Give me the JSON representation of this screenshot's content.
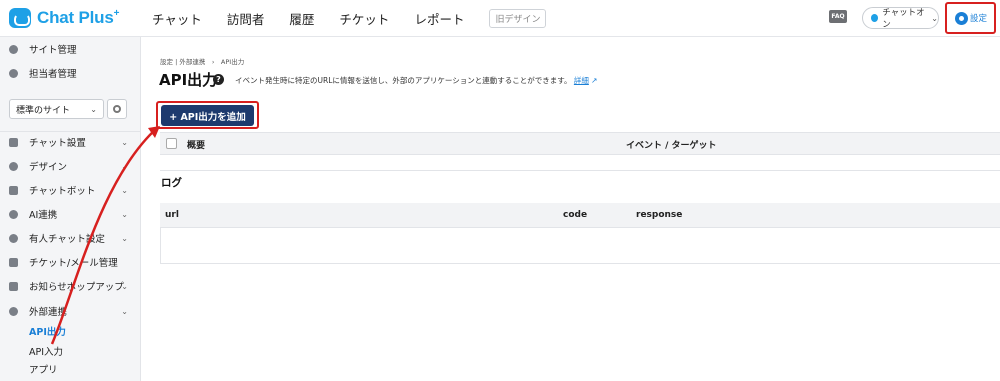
{
  "header": {
    "logo": "Chat Plus",
    "logo_plus": "+",
    "nav": [
      "チャット",
      "訪問者",
      "履歴",
      "チケット",
      "レポート"
    ],
    "old_design": "旧デザイン",
    "faq": "FAQ",
    "chat_status": "チャットオン",
    "settings": "設定"
  },
  "sidebar": {
    "site_manage": "サイト管理",
    "staff_manage": "担当者管理",
    "site_select": "標準のサイト",
    "items": [
      "チャット設置",
      "デザイン",
      "チャットボット",
      "AI連携",
      "有人チャット設定",
      "チケット/メール管理",
      "お知らせポップアップ",
      "外部連携"
    ],
    "subitems": [
      "API出力",
      "API入力",
      "アプリ"
    ]
  },
  "main": {
    "breadcrumb": "設定 | 外部連携　›　API出力",
    "title": "API出力",
    "help": "?",
    "description": "イベント発生時に特定のURLに情報を送信し、外部のアプリケーションと連動することができます。",
    "detail_link": "詳細",
    "add_button": "+ API出力を追加",
    "table_headers": [
      "概要",
      "イベント / ターゲット"
    ],
    "log_title": "ログ",
    "log_headers": [
      "url",
      "code",
      "response"
    ]
  },
  "colors": {
    "brand": "#1ea0e6",
    "button": "#1d3a6e",
    "highlight": "#d7201f",
    "active_link": "#1a7fd6"
  }
}
